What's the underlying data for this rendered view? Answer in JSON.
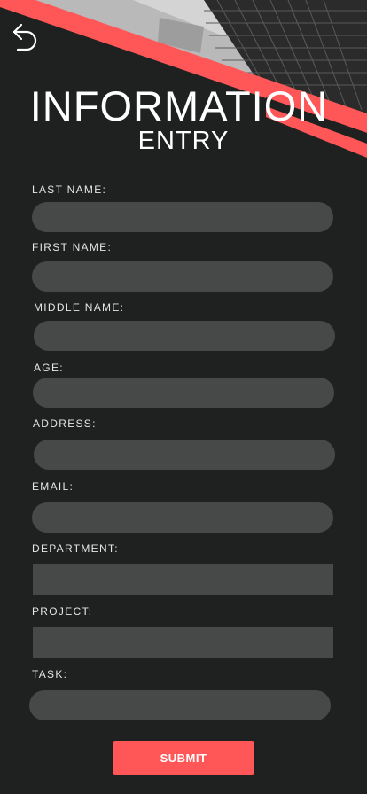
{
  "header": {
    "title": "INFORMATION",
    "subtitle": "ENTRY"
  },
  "form": {
    "fields": [
      {
        "label": "LAST NAME:",
        "value": ""
      },
      {
        "label": "FIRST NAME:",
        "value": ""
      },
      {
        "label": "MIDDLE NAME:",
        "value": ""
      },
      {
        "label": "AGE:",
        "value": ""
      },
      {
        "label": "ADDRESS:",
        "value": ""
      },
      {
        "label": "EMAIL:",
        "value": ""
      },
      {
        "label": "DEPARTMENT:",
        "value": ""
      },
      {
        "label": "PROJECT:",
        "value": ""
      },
      {
        "label": "TASK:",
        "value": ""
      }
    ],
    "submit_label": "SUBMIT"
  },
  "colors": {
    "background": "#1f2121",
    "accent": "#ff5757",
    "field": "#474948",
    "text": "#ffffff"
  },
  "icons": {
    "back": "back-arrow-icon"
  }
}
